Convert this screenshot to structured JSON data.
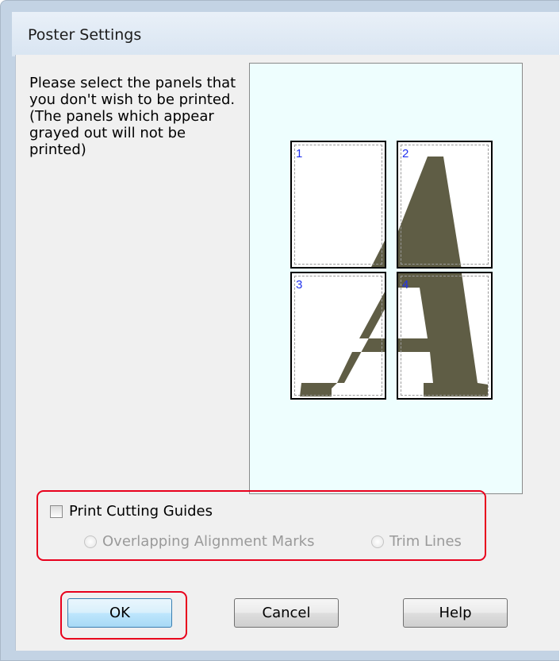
{
  "dialog": {
    "title": "Poster Settings",
    "instructions": "Please select the panels that you don't wish to be printed. (The panels which appear grayed out will not be printed)"
  },
  "panels": [
    {
      "number": "1"
    },
    {
      "number": "2"
    },
    {
      "number": "3"
    },
    {
      "number": "4"
    }
  ],
  "print_cutting_guides": {
    "label": "Print Cutting Guides",
    "checked": false
  },
  "guide_options": [
    {
      "label": "Overlapping Alignment Marks",
      "enabled": false
    },
    {
      "label": "Trim Lines",
      "enabled": false
    }
  ],
  "buttons": {
    "ok": "OK",
    "cancel": "Cancel",
    "help": "Help"
  },
  "colors": {
    "highlight": "#e8001c",
    "letter_fill": "#5f5d45",
    "panel_number": "#2233ee",
    "preview_background": "#eefefe"
  },
  "icons": {
    "checkbox": "checkbox-unchecked",
    "radio": "radio-disabled"
  }
}
